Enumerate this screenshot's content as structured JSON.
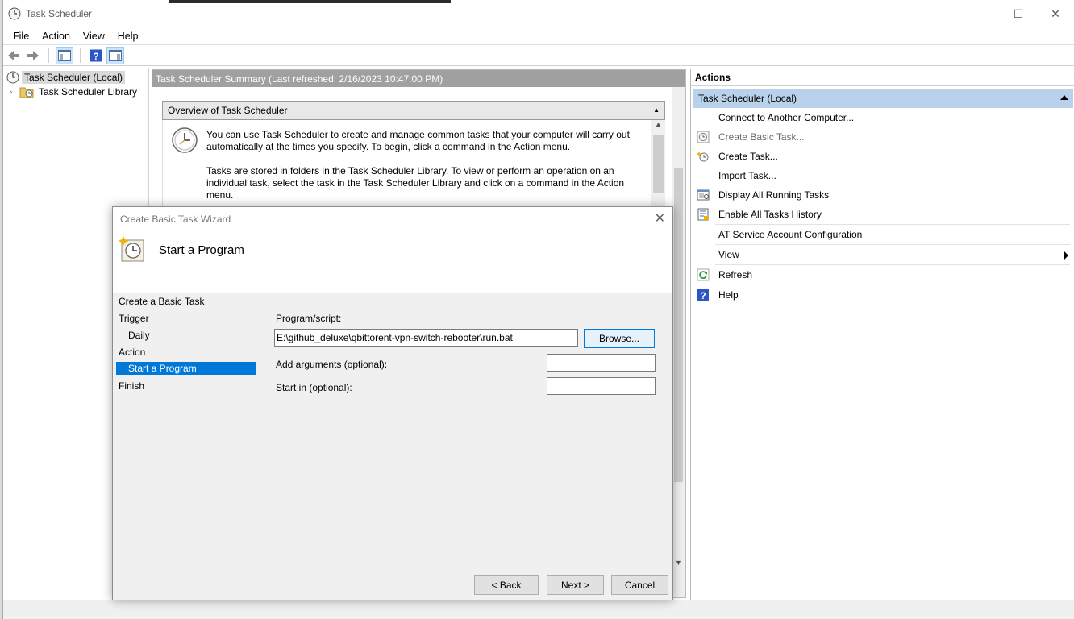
{
  "window": {
    "title": "Task Scheduler",
    "minimize_icon": "—",
    "maximize_icon": "☐",
    "close_icon": "✕"
  },
  "menu": [
    "File",
    "Action",
    "View",
    "Help"
  ],
  "tree": {
    "root": "Task Scheduler (Local)",
    "library": "Task Scheduler Library"
  },
  "center": {
    "header": "Task Scheduler Summary (Last refreshed: 2/16/2023 10:47:00 PM)",
    "overview_title": "Overview of Task Scheduler",
    "paragraph1": "You can use Task Scheduler to create and manage common tasks that your computer will carry out automatically at the times you specify. To begin, click a command in the Action menu.",
    "paragraph2": "Tasks are stored in folders in the Task Scheduler Library. To view or perform an operation on an individual task, select the task in the Task Scheduler Library and click on a command in the Action menu."
  },
  "actions": {
    "title": "Actions",
    "group": "Task Scheduler (Local)",
    "items": [
      {
        "label": "Connect to Another Computer...",
        "icon": "none"
      },
      {
        "label": "Create Basic Task...",
        "icon": "basic-task-icon"
      },
      {
        "label": "Create Task...",
        "icon": "create-task-icon"
      },
      {
        "label": "Import Task...",
        "icon": "none"
      },
      {
        "label": "Display All Running Tasks",
        "icon": "running-tasks-icon"
      },
      {
        "label": "Enable All Tasks History",
        "icon": "history-icon"
      },
      {
        "label": "AT Service Account Configuration",
        "icon": "none"
      },
      {
        "label": "View",
        "icon": "none"
      },
      {
        "label": "Refresh",
        "icon": "refresh-icon"
      },
      {
        "label": "Help",
        "icon": "help-icon"
      }
    ]
  },
  "wizard": {
    "title": "Create Basic Task Wizard",
    "heading": "Start a Program",
    "steps": [
      "Create a Basic Task",
      "Trigger",
      "Daily",
      "Action",
      "Start a Program",
      "Finish"
    ],
    "program_label": "Program/script:",
    "program_value": "E:\\github_deluxe\\qbittorent-vpn-switch-rebooter\\run.bat",
    "browse": "Browse...",
    "args_label": "Add arguments (optional):",
    "args_value": "",
    "startin_label": "Start in (optional):",
    "startin_value": "",
    "back": "< Back",
    "next": "Next >",
    "cancel": "Cancel"
  }
}
